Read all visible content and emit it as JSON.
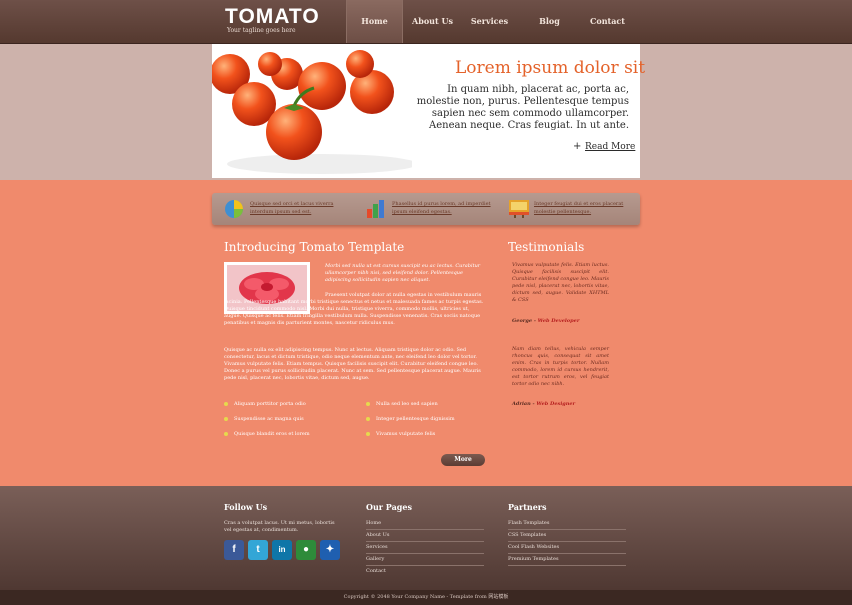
{
  "header": {
    "logo": "TOMATO",
    "tagline": "Your tagline goes here",
    "nav": [
      "Home",
      "About Us",
      "Services",
      "Blog",
      "Contact"
    ],
    "active_nav": "Home"
  },
  "hero": {
    "title": "Lorem ipsum dolor sit",
    "text": "In quam nibh, placerat ac, porta ac, molestie non, purus. Pellentesque tempus sapien nec sem commodo ullamcorper. Aenean neque. Cras feugiat. In ut ante.",
    "read_more": "Read More"
  },
  "features": [
    {
      "text": "Quisque sed orci et lacus viverra interdum ipsum sed est.",
      "icon": "pie-chart-icon"
    },
    {
      "text": "Phasellus id purus lorem, ad imperdiet ipsum eleifend egestas.",
      "icon": "bar-chart-icon"
    },
    {
      "text": "Integer feugiat dui et eros placerat molestie pellentesque.",
      "icon": "presentation-icon"
    }
  ],
  "intro": {
    "title": "Introducing Tomato Template",
    "italic_text": "Morbi sed nulla ut est cursus suscipit eu ac lectus. Curabitur ullamcorper nibh nisi, sed eleifend dolor. Pellentesque adipiscing sollicitudin sapien nec aliquet.",
    "para1": "Praesent volutpat dolor at nulla egestas in vestibulum mauris lacinia. Pellentesque habitant morbi tristique senectus et netus et malesuada fames ac turpis egestas. Quisque tincidunt commodo nisl. Morbi dui nulla, tristique viverra, commodo mollis, ultricies ut, augue. Quisque ac felis. Etiam fringilla vestibulum nulla. Suspendisse venenatis. Cras sociis natoque penatibus et magnis dis parturient montes, nascetur ridiculus mus.",
    "para2": "Quisque ac nulla ex elit adipiscing tempus. Nunc at lectus. Aliquam tristique dolor ac odio. Sed consectetur, lacus et dictum tristique, odio neque elementum ante, nec eleifend leo dolor vel tortor. Vivamus vulputate felis. Etiam tempus. Quisque facilisis suscipit elit. Curabitur eleifend congue leo. Donec a purus vel purus sollicitudin placerat. Nunc at sem. Sed pellentesque placerat augue. Mauris pede nisl, placerat nec, lobortis vitae, dictum sed, augue.",
    "bullets_left": [
      "Aliquam porttitor porta odio",
      "Suspendisse ac magna quis",
      "Quisque blandit eros et lorem"
    ],
    "bullets_right": [
      "Nulla sed leo sed sapien",
      "Integer pellentesque dignissim",
      "Vivamus vulputate felis"
    ],
    "more": "More"
  },
  "testimonials": {
    "title": "Testimonials",
    "items": [
      {
        "text": "Vivamus vulputate felis. Etiam luctus. Quisque facilisis suscipit elit. Curabitur eleifend congue leo. Mauris pede nisl, placerat nec, lobortis vitae, dictum sed, augue. Validate XHTML & CSS",
        "name": "George",
        "role": "Web Developer"
      },
      {
        "text": "Nam diam tellus, vehicula semper rhoncus quis, consequat sit amet enim. Cras in turpis tortor. Nullam commodo, lorem id cursus hendrerit, est tortor rutrum eros, vel feugiat tortor odio nec nibh.",
        "name": "Adrian",
        "role": "Web Designer"
      }
    ]
  },
  "footer": {
    "follow": {
      "title": "Follow Us",
      "text": "Cras a volutpat lacus. Ut mi metus, lobortis vel egestas at, condimentum."
    },
    "social": [
      {
        "icon": "facebook-icon",
        "glyph": "f",
        "color": "#3b5998"
      },
      {
        "icon": "twitter-icon",
        "glyph": "t",
        "color": "#33a6d6"
      },
      {
        "icon": "linkedin-icon",
        "glyph": "in",
        "color": "#0e76a8"
      },
      {
        "icon": "chat-icon",
        "glyph": "●",
        "color": "#2e8b3a"
      },
      {
        "icon": "windows-live-icon",
        "glyph": "✦",
        "color": "#1f5fb0"
      }
    ],
    "pages": {
      "title": "Our Pages",
      "links": [
        "Home",
        "About Us",
        "Services",
        "Gallery",
        "Contact"
      ]
    },
    "partners": {
      "title": "Partners",
      "links": [
        "Flash Templates",
        "CSS Templates",
        "Cool Flash Websites",
        "Premium Templates"
      ]
    },
    "copyright": "Copyright © 2048 Your Company Name - Template from 网站模板"
  },
  "colors": {
    "accent": "#e4622a",
    "header": "#5e4239",
    "body": "#f08a6c"
  }
}
